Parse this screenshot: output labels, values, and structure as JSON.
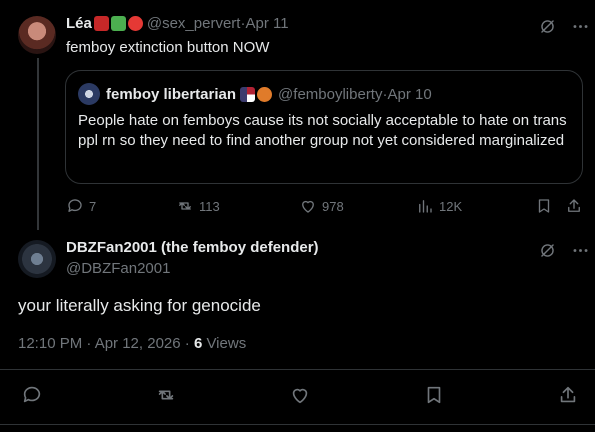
{
  "tweet1": {
    "author_name": "Léa",
    "emojis": [
      "ladybug-emoji",
      "tractor-emoji",
      "lifebuoy-emoji"
    ],
    "handle": "@sex_pervert",
    "separator": " · ",
    "date": "Apr 11",
    "text": "femboy extinction button NOW",
    "quote": {
      "author_name": "femboy libertarian",
      "emojis": [
        "us-flag-emoji",
        "fox-emoji"
      ],
      "handle": "@femboyliberty",
      "separator": " · ",
      "date": "Apr 10",
      "text": "People hate on femboys cause its not socially acceptable to hate on trans ppl rn so they need to find another group not yet considered marginalized"
    },
    "actions": {
      "replies": "7",
      "reposts": "113",
      "likes": "978",
      "views": "12K"
    }
  },
  "tweet2": {
    "author_name": "DBZFan2001 (the femboy defender)",
    "handle": "@DBZFan2001",
    "text": "your literally asking for genocide",
    "time": "12:10 PM · Apr 12, 2026 · ",
    "views_count": "6",
    "views_label": " Views"
  },
  "colors": {
    "background": "#000000",
    "text": "#e7e9ea",
    "muted": "#71767b",
    "border": "#2f3336"
  }
}
